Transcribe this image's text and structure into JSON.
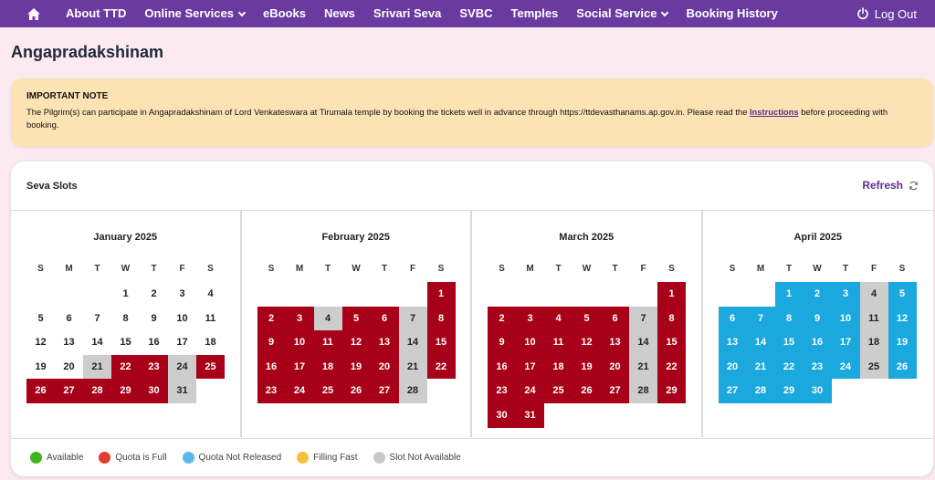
{
  "nav": {
    "items": [
      {
        "label": "About TTD",
        "dropdown": false
      },
      {
        "label": "Online Services",
        "dropdown": true
      },
      {
        "label": "eBooks",
        "dropdown": false
      },
      {
        "label": "News",
        "dropdown": false
      },
      {
        "label": "Srivari Seva",
        "dropdown": false
      },
      {
        "label": "SVBC",
        "dropdown": false
      },
      {
        "label": "Temples",
        "dropdown": false
      },
      {
        "label": "Social Service",
        "dropdown": true
      },
      {
        "label": "Booking History",
        "dropdown": false
      }
    ],
    "logout": "Log Out"
  },
  "page": {
    "title": "Angapradakshinam"
  },
  "note": {
    "title": "IMPORTANT NOTE",
    "text_before": "The Pilgrim(s) can participate in Angapradakshinam of Lord Venkateswara at Tirumala temple by booking the tickets well in advance through https://ttdevasthanams.ap.gov.in. Please read the ",
    "link": "Instructions",
    "text_after": " before proceeding with booking."
  },
  "slots": {
    "title": "Seva Slots",
    "refresh": "Refresh"
  },
  "weekdays": [
    "S",
    "M",
    "T",
    "W",
    "T",
    "F",
    "S"
  ],
  "months": [
    {
      "title": "January 2025",
      "start": 3,
      "days": 31,
      "status": {
        "21": "na",
        "22": "full",
        "23": "full",
        "24": "na",
        "25": "full",
        "26": "full",
        "27": "full",
        "28": "full",
        "29": "full",
        "30": "full",
        "31": "na"
      }
    },
    {
      "title": "February 2025",
      "start": 6,
      "days": 28,
      "status": {
        "1": "full",
        "2": "full",
        "3": "full",
        "4": "na",
        "5": "full",
        "6": "full",
        "7": "na",
        "8": "full",
        "9": "full",
        "10": "full",
        "11": "full",
        "12": "full",
        "13": "full",
        "14": "na",
        "15": "full",
        "16": "full",
        "17": "full",
        "18": "full",
        "19": "full",
        "20": "full",
        "21": "na",
        "22": "full",
        "23": "full",
        "24": "full",
        "25": "full",
        "26": "full",
        "27": "full",
        "28": "na"
      }
    },
    {
      "title": "March 2025",
      "start": 6,
      "days": 31,
      "status": {
        "1": "full",
        "2": "full",
        "3": "full",
        "4": "full",
        "5": "full",
        "6": "full",
        "7": "na",
        "8": "full",
        "9": "full",
        "10": "full",
        "11": "full",
        "12": "full",
        "13": "full",
        "14": "na",
        "15": "full",
        "16": "full",
        "17": "full",
        "18": "full",
        "19": "full",
        "20": "full",
        "21": "na",
        "22": "full",
        "23": "full",
        "24": "full",
        "25": "full",
        "26": "full",
        "27": "full",
        "28": "na",
        "29": "full",
        "30": "full",
        "31": "full"
      }
    },
    {
      "title": "April 2025",
      "start": 2,
      "days": 30,
      "status": {
        "1": "nr",
        "2": "nr",
        "3": "nr",
        "4": "na",
        "5": "nr",
        "6": "nr",
        "7": "nr",
        "8": "nr",
        "9": "nr",
        "10": "nr",
        "11": "na",
        "12": "nr",
        "13": "nr",
        "14": "nr",
        "15": "nr",
        "16": "nr",
        "17": "nr",
        "18": "na",
        "19": "nr",
        "20": "nr",
        "21": "nr",
        "22": "nr",
        "23": "nr",
        "24": "nr",
        "25": "na",
        "26": "nr",
        "27": "nr",
        "28": "nr",
        "29": "nr",
        "30": "nr"
      }
    }
  ],
  "legend": [
    {
      "label": "Available",
      "color": "#3cb521"
    },
    {
      "label": "Quota is Full",
      "color": "#e23b2e"
    },
    {
      "label": "Quota Not Released",
      "color": "#5db8e8"
    },
    {
      "label": "Filling Fast",
      "color": "#f5c13b"
    },
    {
      "label": "Slot Not Available",
      "color": "#c8c8c8"
    }
  ],
  "colors": {
    "nav": "#6b3aa0",
    "full": "#a80018",
    "not_released": "#1aa8de",
    "not_available": "#cdcdcd"
  }
}
